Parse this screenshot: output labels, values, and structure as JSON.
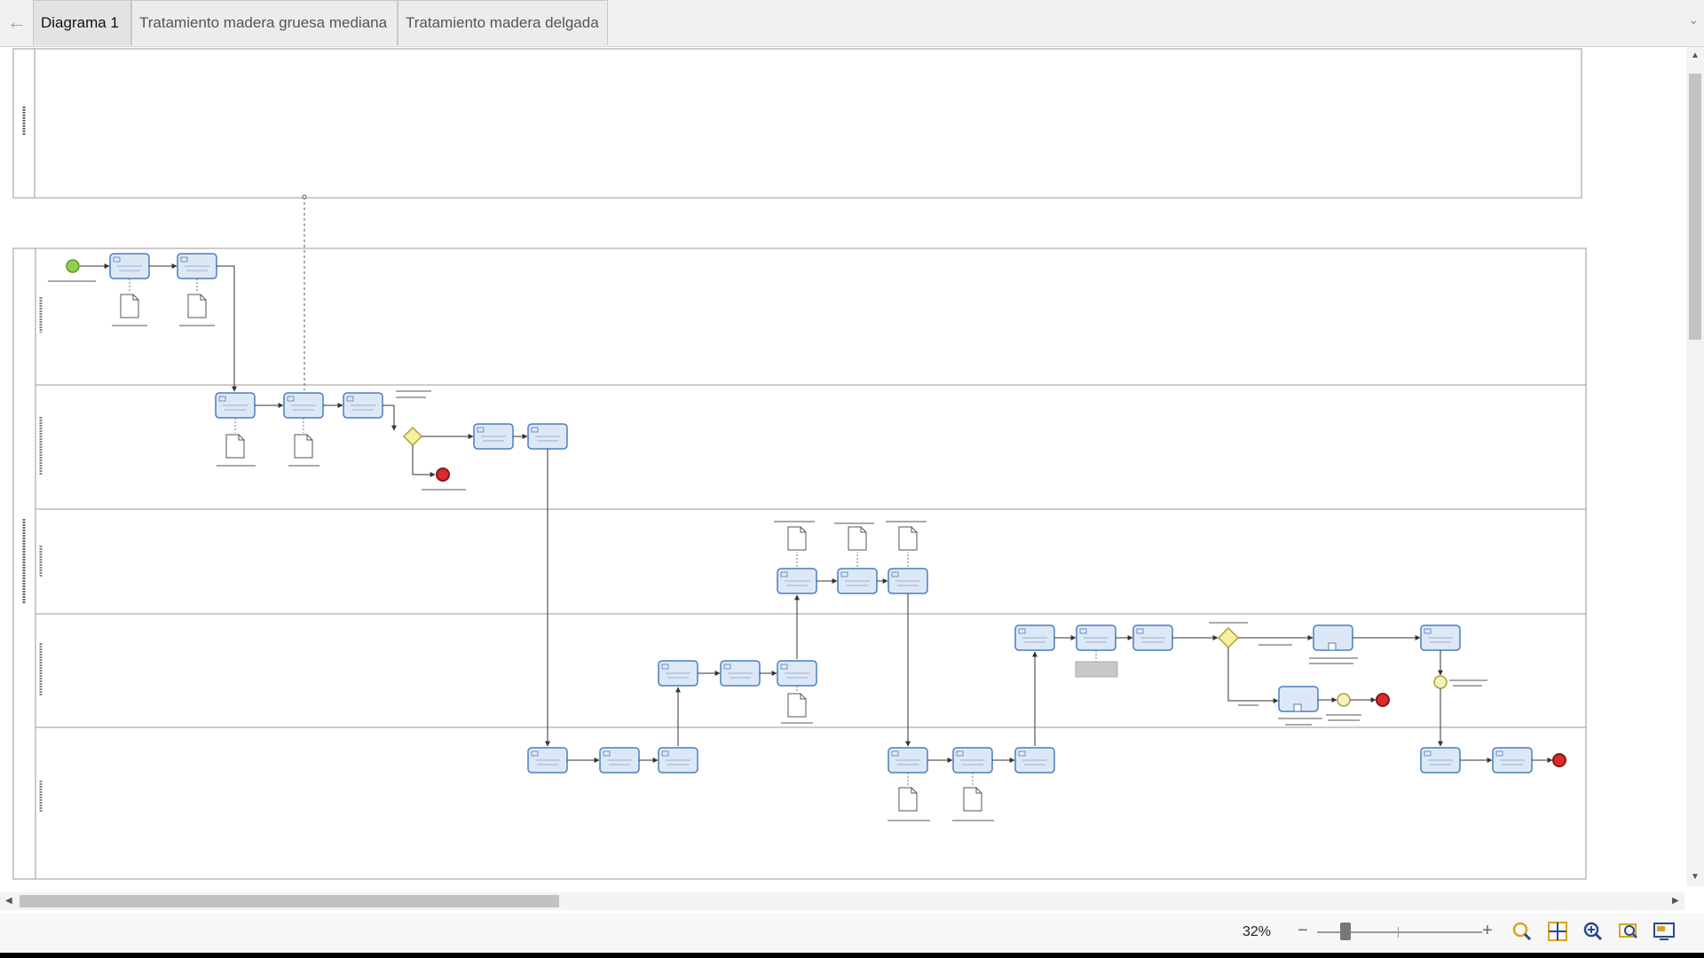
{
  "tabs": [
    {
      "label": "Diagrama 1",
      "active": true
    },
    {
      "label": "Tratamiento madera gruesa  mediana",
      "active": false
    },
    {
      "label": "Tratamiento madera delgada",
      "active": false
    }
  ],
  "status": {
    "zoom": "32%",
    "zoom_minus": "−",
    "zoom_plus": "+"
  },
  "colors": {
    "task_fill": "#dde8f7",
    "task_stroke": "#4a7ebb",
    "gateway": "#f5f0a0",
    "start_event": "#8fd14f",
    "end_event": "#d92b2b"
  },
  "icons": [
    "back-arrow-icon",
    "chevron-down-icon",
    "zoom-fit-icon",
    "grid-icon",
    "zoom-in-icon",
    "zoom-area-icon",
    "overview-icon"
  ]
}
